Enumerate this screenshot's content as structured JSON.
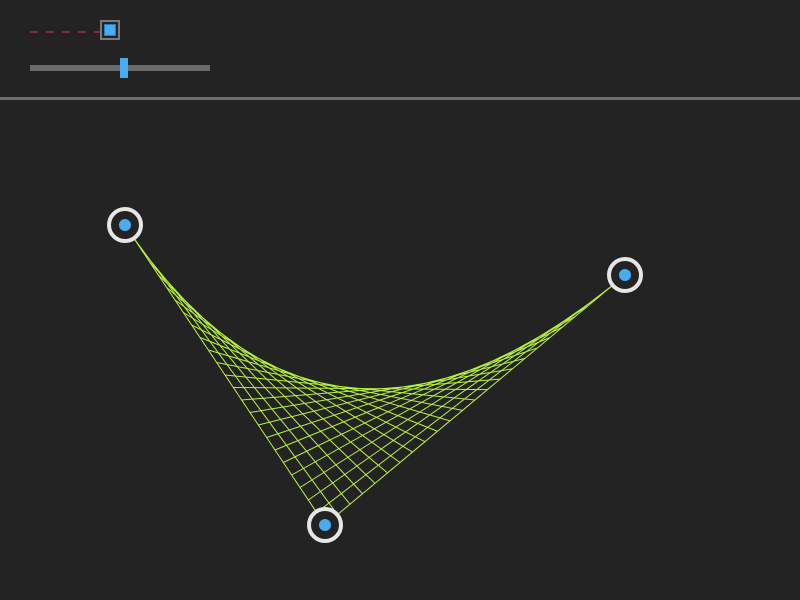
{
  "colors": {
    "background": "#232323",
    "curve_lines": "#b6f23e",
    "control_polygon_dash": "#e0336c",
    "handle_ring": "#e6e6e6",
    "handle_center": "#4aacf0",
    "accent": "#4aacf0",
    "track": "#6a6a6a",
    "divider": "#6e6e6e"
  },
  "toolbar": {
    "show_control_lines": {
      "checked": true,
      "sample_icon": "dashed-line-icon"
    },
    "density_slider": {
      "value": 0.52
    }
  },
  "curve": {
    "type": "quadratic-bezier-string-art",
    "line_count": 24
  }
}
